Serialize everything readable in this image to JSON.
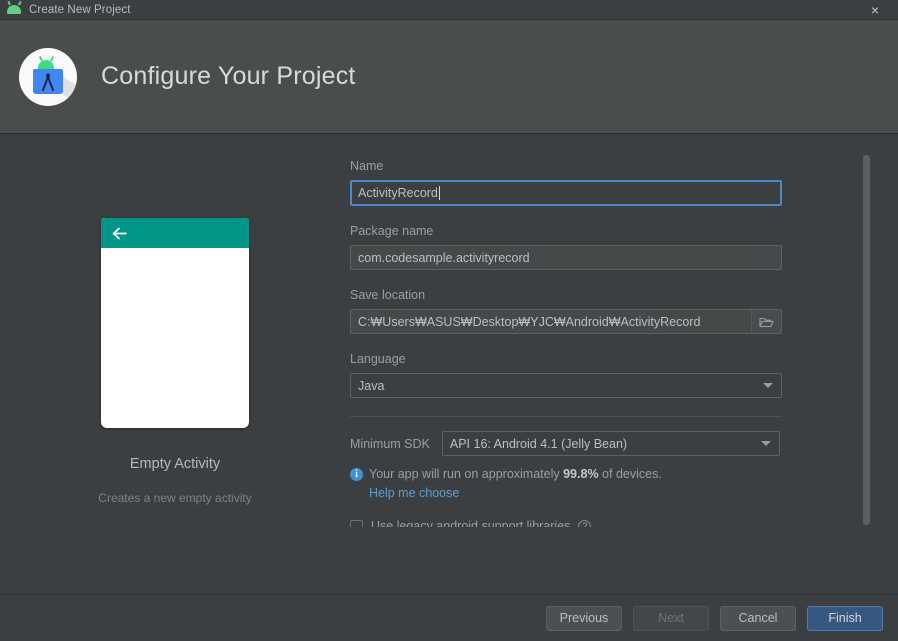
{
  "window": {
    "title": "Create New Project",
    "icon": "android-robot-icon",
    "close_label": "×"
  },
  "header": {
    "title": "Configure Your Project",
    "logo": "android-studio-logo"
  },
  "preview": {
    "template_name": "Empty Activity",
    "template_description": "Creates a new empty activity",
    "appbar_color": "#009688",
    "back_icon": "arrow-left-icon"
  },
  "form": {
    "name": {
      "label": "Name",
      "value": "ActivityRecord",
      "focused": true
    },
    "package_name": {
      "label": "Package name",
      "value": "com.codesample.activityrecord"
    },
    "save_location": {
      "label": "Save location",
      "value": "C:₩Users₩ASUS₩Desktop₩YJC₩Android₩ActivityRecord",
      "browse_icon": "folder-icon"
    },
    "language": {
      "label": "Language",
      "value": "Java"
    },
    "minimum_sdk": {
      "label": "Minimum SDK",
      "value": "API 16: Android 4.1 (Jelly Bean)"
    },
    "device_info": {
      "icon": "info-icon",
      "text_before": "Your app will run on approximately",
      "percent": "99.8%",
      "text_after": "of devices.",
      "help_link": "Help me choose"
    },
    "legacy_checkbox": {
      "label": "Use legacy android support libraries",
      "checked": false,
      "help_icon": "question-mark-icon"
    }
  },
  "footer": {
    "previous": "Previous",
    "next": "Next",
    "cancel": "Cancel",
    "finish": "Finish"
  },
  "colors": {
    "accent_blue": "#365880",
    "link_blue": "#5a9fd4",
    "teal": "#009688",
    "focus_border": "#4a88c7"
  }
}
